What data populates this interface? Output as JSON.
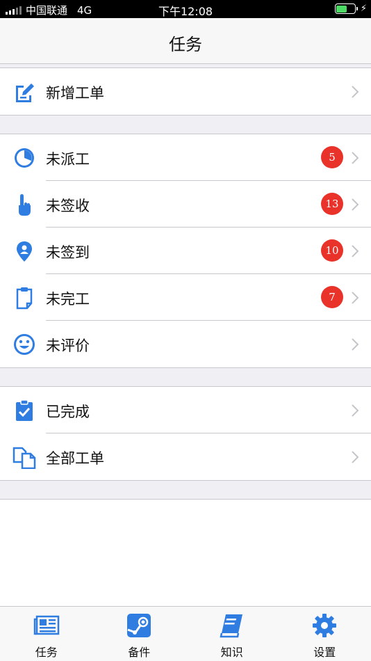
{
  "status_bar": {
    "carrier": "中国联通",
    "network": "4G",
    "time": "下午12:08"
  },
  "nav": {
    "title": "任务"
  },
  "sections": [
    {
      "rows": [
        {
          "key": "new",
          "label": "新增工单",
          "icon": "add-order-icon"
        }
      ]
    },
    {
      "rows": [
        {
          "key": "undispatched",
          "label": "未派工",
          "badge": "5",
          "icon": "clock-icon"
        },
        {
          "key": "unsigned",
          "label": "未签收",
          "badge": "13",
          "icon": "tap-hand-icon"
        },
        {
          "key": "uncheckin",
          "label": "未签到",
          "badge": "10",
          "icon": "location-pin-icon"
        },
        {
          "key": "unfinished",
          "label": "未完工",
          "badge": "7",
          "icon": "clipboard-icon"
        },
        {
          "key": "unrated",
          "label": "未评价",
          "icon": "smiley-icon"
        }
      ]
    },
    {
      "rows": [
        {
          "key": "completed",
          "label": "已完成",
          "icon": "checked-clipboard-icon"
        },
        {
          "key": "all",
          "label": "全部工单",
          "icon": "documents-icon"
        }
      ]
    }
  ],
  "tabs": [
    {
      "key": "task",
      "label": "任务",
      "icon": "newspaper-icon"
    },
    {
      "key": "parts",
      "label": "备件",
      "icon": "parts-icon"
    },
    {
      "key": "knowledge",
      "label": "知识",
      "icon": "book-icon"
    },
    {
      "key": "settings",
      "label": "设置",
      "icon": "gear-icon"
    }
  ],
  "colors": {
    "accent": "#2f7de1",
    "badge": "#e8322a",
    "gap": "#efeff4",
    "separator": "#c8c8cc",
    "battery": "#4cd964"
  }
}
